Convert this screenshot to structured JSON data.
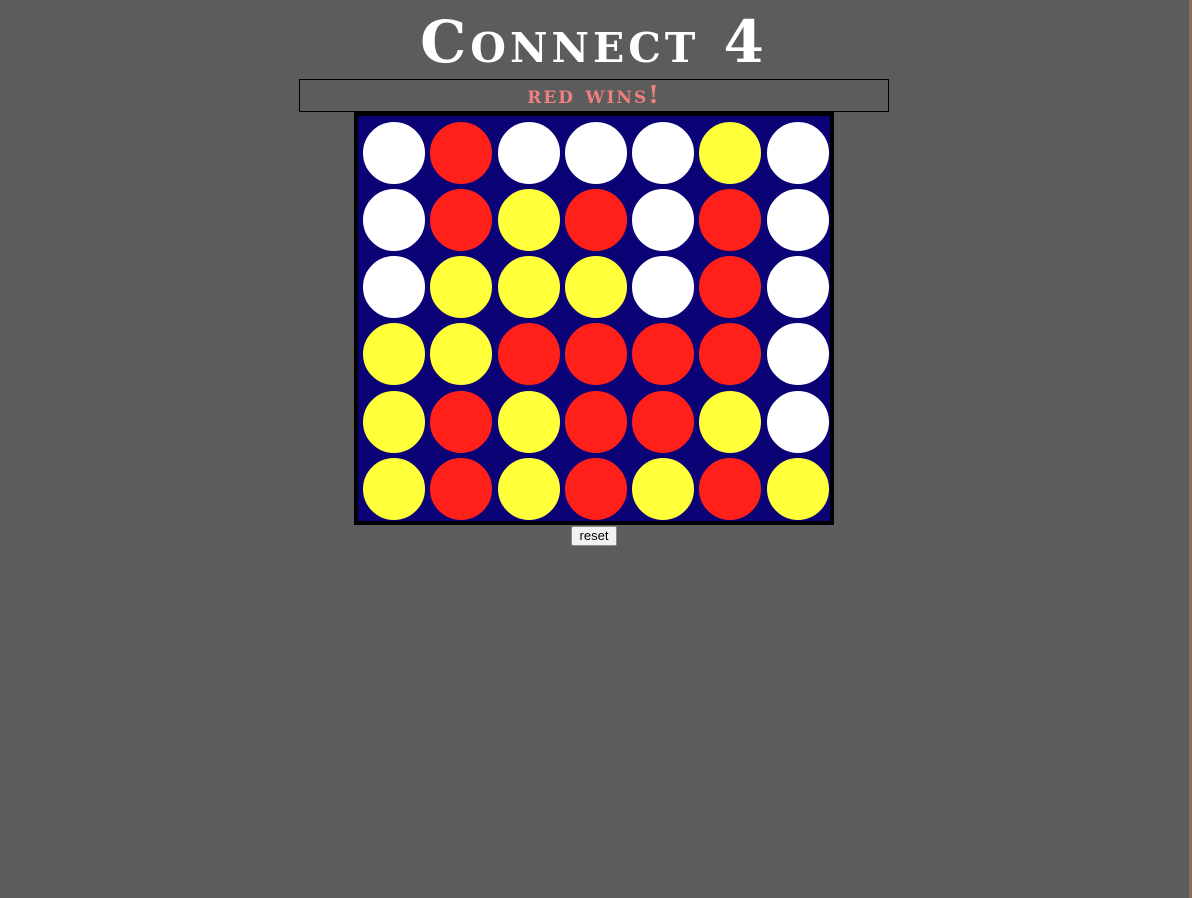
{
  "title": "Connect 4",
  "status": "red wins!",
  "board": {
    "rows": [
      [
        "empty",
        "red",
        "empty",
        "empty",
        "empty",
        "yellow",
        "empty"
      ],
      [
        "empty",
        "red",
        "yellow",
        "red",
        "empty",
        "red",
        "empty"
      ],
      [
        "empty",
        "yellow",
        "yellow",
        "yellow",
        "empty",
        "red",
        "empty"
      ],
      [
        "yellow",
        "yellow",
        "red",
        "red",
        "red",
        "red",
        "empty"
      ],
      [
        "yellow",
        "red",
        "yellow",
        "red",
        "red",
        "yellow",
        "empty"
      ],
      [
        "yellow",
        "red",
        "yellow",
        "red",
        "yellow",
        "red",
        "yellow"
      ]
    ]
  },
  "colors": {
    "background": "#5c5c5c",
    "board": "#0b0275",
    "red": "#ff2119",
    "yellow": "#ffff3a",
    "empty": "#ffffff",
    "status_text": "#f08080"
  },
  "controls": {
    "reset_label": "reset"
  }
}
